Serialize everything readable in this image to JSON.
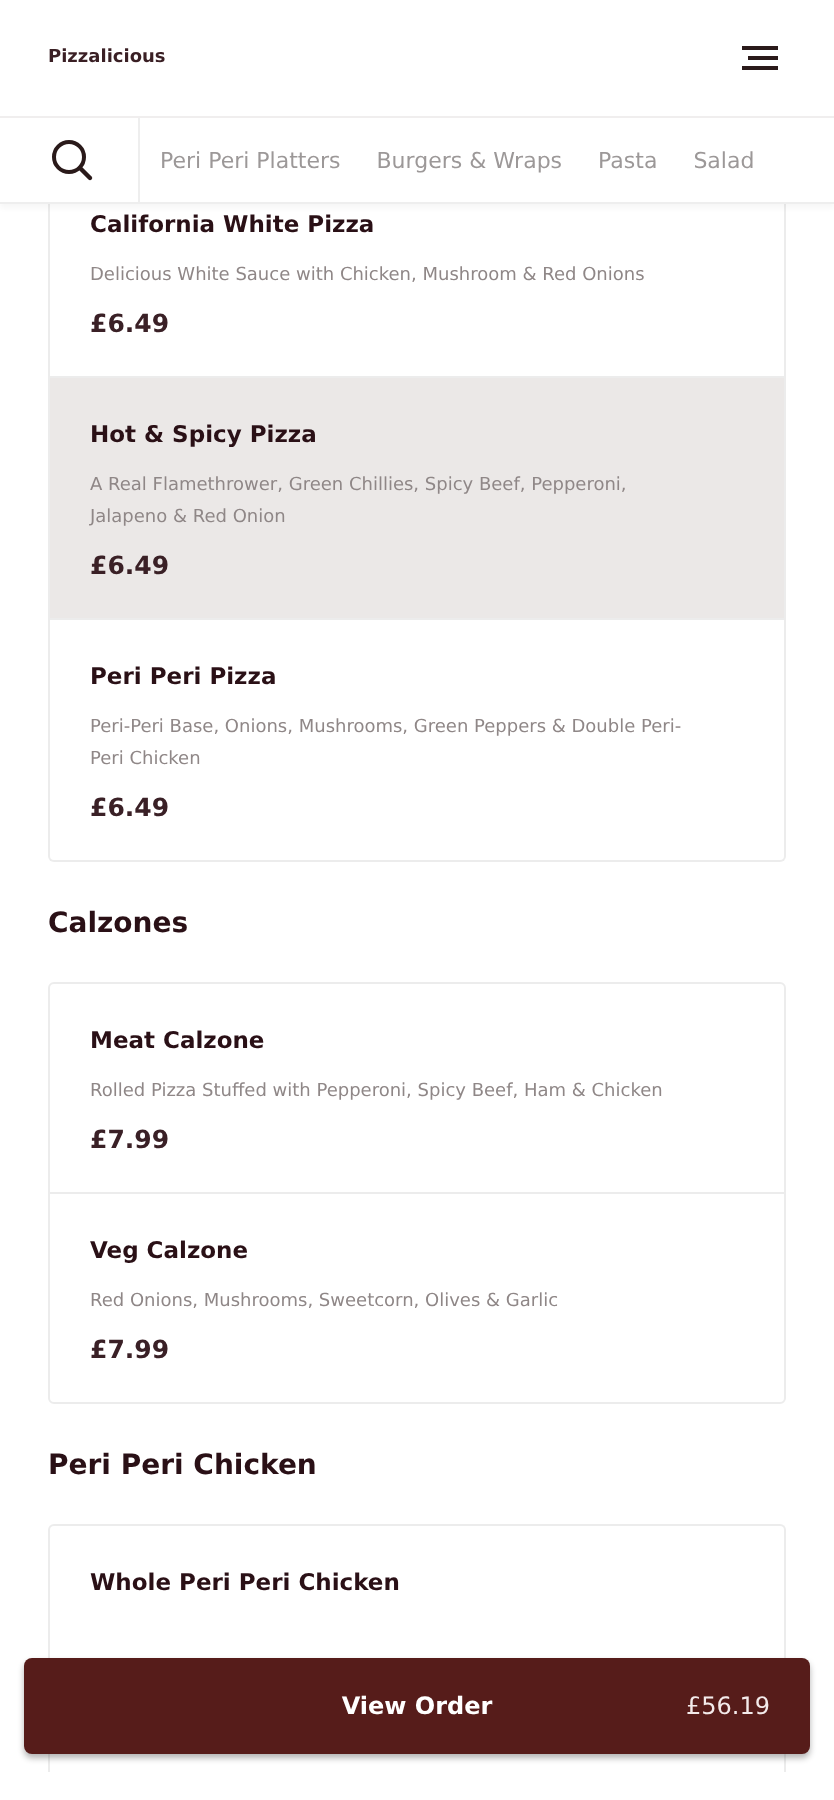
{
  "header": {
    "title": "Pizzalicious"
  },
  "categories": [
    {
      "label": "Peri Peri Platters",
      "selected": false
    },
    {
      "label": "Burgers & Wraps",
      "selected": false
    },
    {
      "label": "Pasta",
      "selected": false
    },
    {
      "label": "Salad",
      "selected": false
    }
  ],
  "sections": [
    {
      "items": [
        {
          "name": "California White Pizza",
          "description": "Delicious White Sauce with Chicken, Mushroom & Red Onions",
          "price": "£6.49",
          "selected": false
        },
        {
          "name": "Hot & Spicy Pizza",
          "description": "A Real Flamethrower, Green Chillies, Spicy Beef, Pepperoni, Jalapeno & Red Onion",
          "price": "£6.49",
          "selected": true
        },
        {
          "name": "Peri Peri Pizza",
          "description": "Peri-Peri Base, Onions, Mushrooms, Green Peppers & Double Peri-Peri Chicken",
          "price": "£6.49",
          "selected": false
        }
      ]
    },
    {
      "title": "Calzones",
      "items": [
        {
          "name": "Meat Calzone",
          "description": "Rolled Pizza Stuffed with Pepperoni, Spicy Beef, Ham & Chicken",
          "price": "£7.99",
          "selected": false
        },
        {
          "name": "Veg Calzone",
          "description": "Red Onions, Mushrooms, Sweetcorn, Olives & Garlic",
          "price": "£7.99",
          "selected": false
        }
      ]
    },
    {
      "title": "Peri Peri Chicken",
      "items": [
        {
          "name": "Whole Peri Peri Chicken",
          "selected": false
        }
      ]
    }
  ],
  "order_button": {
    "label": "View Order",
    "total": "£56.19"
  }
}
